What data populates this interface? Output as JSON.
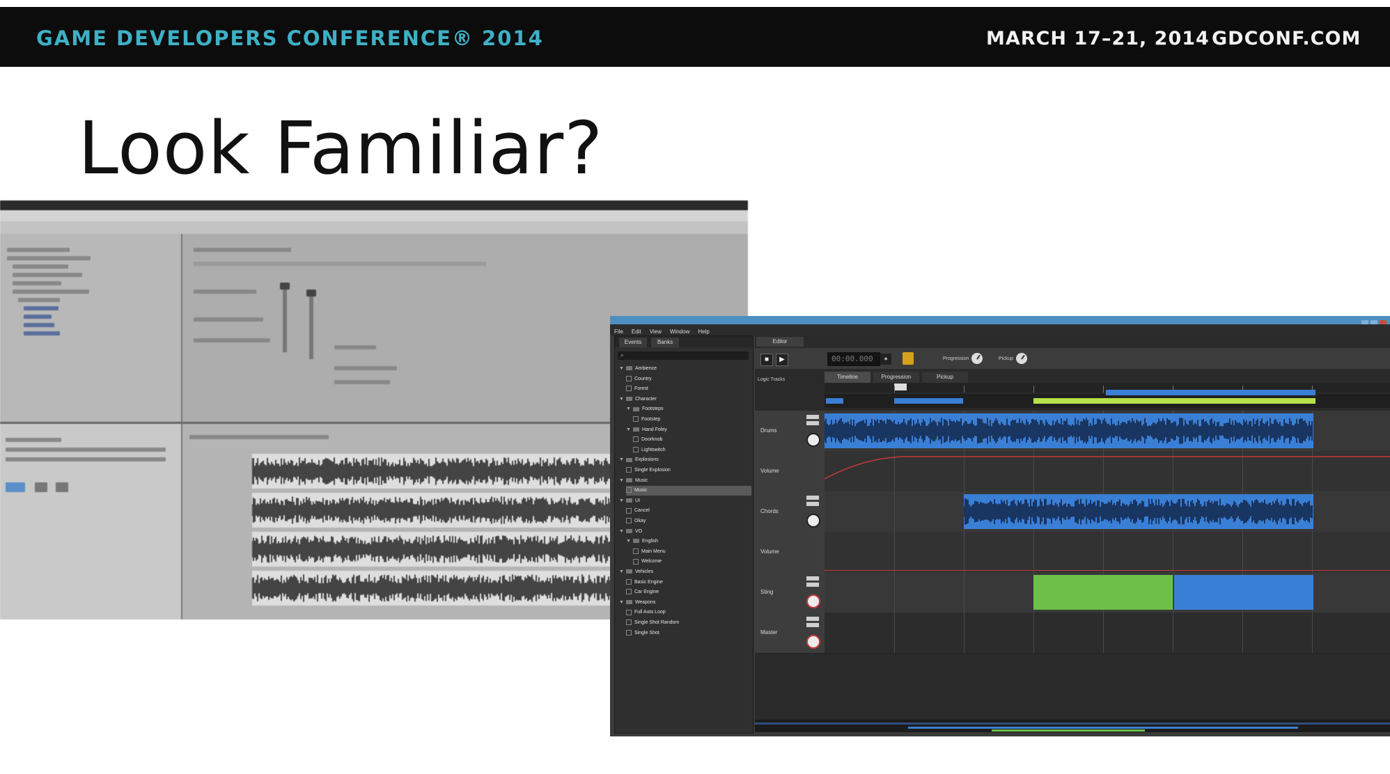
{
  "banner": {
    "conference": "GAME DEVELOPERS CONFERENCE® 2014",
    "dates": "MARCH 17–21, 2014",
    "site": "GDCONF.COM"
  },
  "slide": {
    "title": "Look Familiar?"
  },
  "right_app": {
    "menu": [
      "File",
      "Edit",
      "View",
      "Window",
      "Help"
    ],
    "browser": {
      "tabs": [
        "Events",
        "Banks"
      ],
      "search_icon": "search-icon",
      "tree": [
        {
          "label": "Ambience",
          "level": 0,
          "type": "folder"
        },
        {
          "label": "Country",
          "level": 1,
          "type": "event"
        },
        {
          "label": "Forest",
          "level": 1,
          "type": "event"
        },
        {
          "label": "Character",
          "level": 0,
          "type": "folder"
        },
        {
          "label": "Footsteps",
          "level": 1,
          "type": "folder"
        },
        {
          "label": "Footstep",
          "level": 2,
          "type": "event"
        },
        {
          "label": "Hand Foley",
          "level": 1,
          "type": "folder"
        },
        {
          "label": "Doorknob",
          "level": 2,
          "type": "event"
        },
        {
          "label": "Lightswitch",
          "level": 2,
          "type": "event"
        },
        {
          "label": "Explosions",
          "level": 0,
          "type": "folder"
        },
        {
          "label": "Single Explosion",
          "level": 1,
          "type": "event"
        },
        {
          "label": "Music",
          "level": 0,
          "type": "folder"
        },
        {
          "label": "Music",
          "level": 1,
          "type": "event",
          "selected": true
        },
        {
          "label": "UI",
          "level": 0,
          "type": "folder"
        },
        {
          "label": "Cancel",
          "level": 1,
          "type": "event"
        },
        {
          "label": "Okay",
          "level": 1,
          "type": "event"
        },
        {
          "label": "VO",
          "level": 0,
          "type": "folder"
        },
        {
          "label": "English",
          "level": 1,
          "type": "folder"
        },
        {
          "label": "Main Menu",
          "level": 2,
          "type": "event"
        },
        {
          "label": "Welcome",
          "level": 2,
          "type": "event"
        },
        {
          "label": "Vehicles",
          "level": 0,
          "type": "folder"
        },
        {
          "label": "Basic Engine",
          "level": 1,
          "type": "event"
        },
        {
          "label": "Car Engine",
          "level": 1,
          "type": "event"
        },
        {
          "label": "Weapons",
          "level": 0,
          "type": "folder"
        },
        {
          "label": "Full Auto Loop",
          "level": 1,
          "type": "event"
        },
        {
          "label": "Single Shot Random",
          "level": 1,
          "type": "event"
        },
        {
          "label": "Single Shot",
          "level": 1,
          "type": "event"
        }
      ]
    },
    "editor": {
      "tab": "Editor",
      "timecode": "00:00.000",
      "parameter_tabs": [
        "Timeline",
        "Progression",
        "Pickup"
      ],
      "knob_labels": [
        "Progression",
        "Pickup"
      ],
      "logic_tracks_label": "Logic Tracks",
      "tracks": [
        {
          "name": "Drums",
          "auto": "Volume"
        },
        {
          "name": "Chords",
          "auto": "Volume"
        },
        {
          "name": "Sting",
          "auto": ""
        },
        {
          "name": "Master",
          "auto": ""
        }
      ]
    },
    "colors": {
      "clip_blue": "#3a7fd6",
      "clip_green": "#6cc04a",
      "region_lime": "#b7e04a",
      "loop_amber": "#d6a21c",
      "title_bar": "#4c8fc0",
      "automation_red": "#c63a3a"
    }
  }
}
